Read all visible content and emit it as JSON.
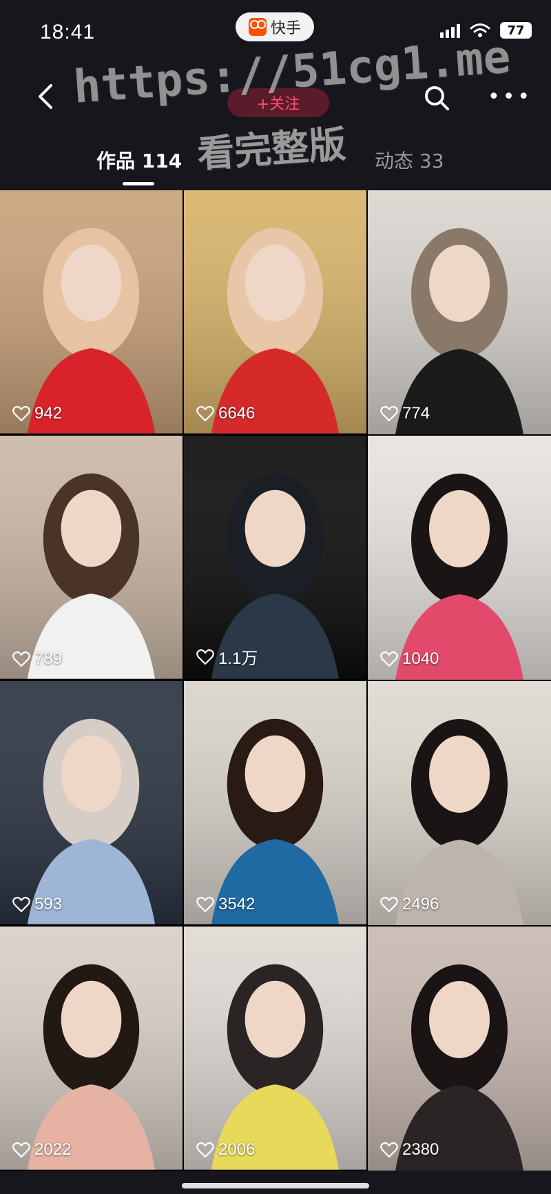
{
  "status_bar": {
    "time": "18:41",
    "app_name": "快手",
    "battery": "77"
  },
  "nav": {
    "follow_label": "+关注"
  },
  "watermark": {
    "line1": "https://51cg1.me",
    "line2": "看完整版"
  },
  "tabs": {
    "works": "作品 114",
    "moments": "动态 33"
  },
  "grid": {
    "items": [
      {
        "likes": "942",
        "palette": [
          "#c9a27a",
          "#e7c3a3",
          "#d8232a"
        ]
      },
      {
        "likes": "6646",
        "palette": [
          "#d8b46a",
          "#e8c7a8",
          "#d62a2a"
        ]
      },
      {
        "likes": "774",
        "palette": [
          "#d9d5cf",
          "#8a7868",
          "#1b1b1b"
        ]
      },
      {
        "likes": "789",
        "palette": [
          "#cbb8a8",
          "#4a3428",
          "#f1f1f1"
        ]
      },
      {
        "likes": "1.1万",
        "palette": [
          "#0d0d0d",
          "#1b1e24",
          "#2a3848"
        ]
      },
      {
        "likes": "1040",
        "palette": [
          "#e7e3df",
          "#1b1414",
          "#e24a6b"
        ]
      },
      {
        "likes": "593",
        "palette": [
          "#2b3442",
          "#d5cdc6",
          "#9db6d8"
        ]
      },
      {
        "likes": "3542",
        "palette": [
          "#d9d3cc",
          "#2a1a14",
          "#1f6aa3"
        ]
      },
      {
        "likes": "2496",
        "palette": [
          "#dfd9d0",
          "#1a1414",
          "#bdb4ad"
        ]
      },
      {
        "likes": "2022",
        "palette": [
          "#d9d0c7",
          "#221814",
          "#e5b2a3"
        ]
      },
      {
        "likes": "2006",
        "palette": [
          "#e0dad4",
          "#2b2424",
          "#e8d95a"
        ]
      },
      {
        "likes": "2380",
        "palette": [
          "#c9b9b2",
          "#1b1414",
          "#2b2424"
        ]
      }
    ]
  }
}
